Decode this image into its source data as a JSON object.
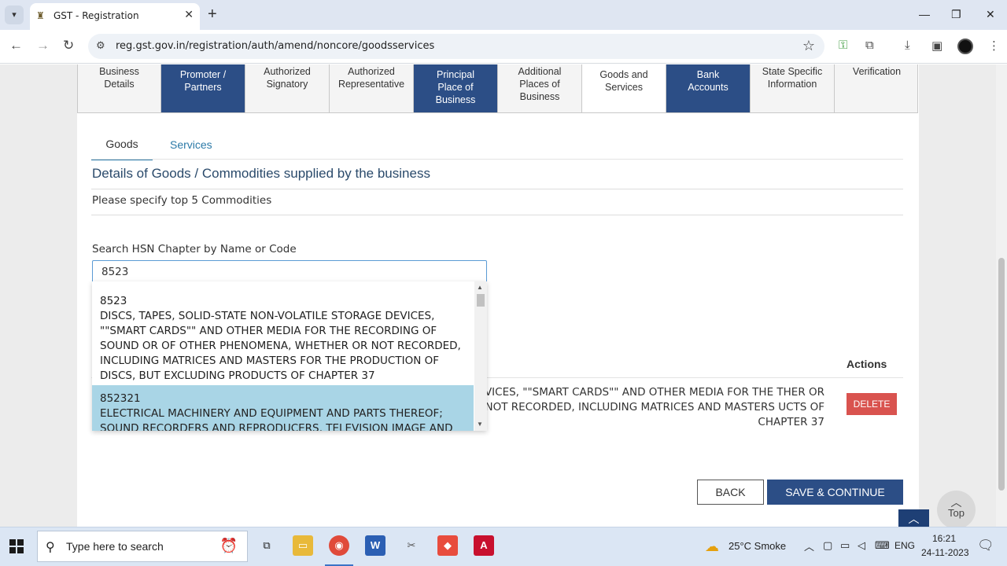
{
  "browser": {
    "tab_title": "GST - Registration",
    "url": "reg.gst.gov.in/registration/auth/amend/noncore/goodsservices"
  },
  "steps": [
    {
      "label": "Business Details",
      "state": "default"
    },
    {
      "label": "Promoter / Partners",
      "state": "done"
    },
    {
      "label": "Authorized Signatory",
      "state": "default"
    },
    {
      "label": "Authorized Representative",
      "state": "default"
    },
    {
      "label": "Principal Place of Business",
      "state": "done"
    },
    {
      "label": "Additional Places of Business",
      "state": "default"
    },
    {
      "label": "Goods and Services",
      "state": "active"
    },
    {
      "label": "Bank Accounts",
      "state": "done"
    },
    {
      "label": "State Specific Information",
      "state": "default"
    },
    {
      "label": "Verification",
      "state": "default"
    }
  ],
  "tabs": {
    "goods": "Goods",
    "services": "Services"
  },
  "section_title": "Details of Goods / Commodities supplied by the business",
  "specify_text": "Please specify top 5 Commodities",
  "search": {
    "label": "Search HSN Chapter by Name or Code",
    "value": "8523"
  },
  "dropdown": [
    {
      "code": "8523",
      "desc": "DISCS, TAPES, SOLID-STATE NON-VOLATILE STORAGE DEVICES, \"\"SMART CARDS\"\" AND OTHER MEDIA FOR THE RECORDING OF SOUND OR OF OTHER PHENOMENA, WHETHER OR NOT RECORDED, INCLUDING MATRICES AND MASTERS FOR THE PRODUCTION OF DISCS, BUT EXCLUDING PRODUCTS OF CHAPTER 37"
    },
    {
      "code": "852321",
      "desc": "ELECTRICAL MACHINERY AND EQUIPMENT AND PARTS THEREOF; SOUND RECORDERS AND REPRODUCERS, TELEVISION IMAGE AND"
    }
  ],
  "table": {
    "actions_header": "Actions",
    "row_desc": "VICES, \"\"SMART CARDS\"\" AND OTHER MEDIA FOR THE THER OR NOT RECORDED, INCLUDING MATRICES AND MASTERS UCTS OF CHAPTER 37",
    "delete_label": "DELETE"
  },
  "buttons": {
    "back": "BACK",
    "save": "SAVE & CONTINUE",
    "top": "Top"
  },
  "taskbar": {
    "search_placeholder": "Type here to search",
    "weather": "25°C  Smoke",
    "lang": "ENG",
    "time": "16:21",
    "date": "24-11-2023"
  },
  "colors": {
    "primary": "#2c4e86",
    "delete": "#d9534f",
    "highlight": "#a9d5e6",
    "link": "#2c7aa8"
  }
}
